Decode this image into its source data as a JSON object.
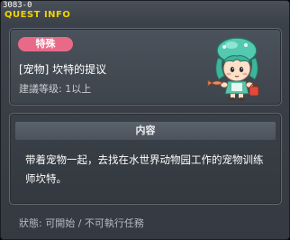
{
  "window": {
    "quest_id": "3083-0",
    "title": "QUEST INFO"
  },
  "quest": {
    "type_badge": "特殊",
    "name": "[宠物] 坎特的提议",
    "level": "建議等级: 1以上",
    "npc_icon": "npc-character-icon"
  },
  "content": {
    "header": "内容",
    "description": "带着宠物一起，去找在水世界动物园工作的宠物训练师坎特。"
  },
  "status": {
    "text": "狀態: 可開始 / 不可執行任務"
  },
  "colors": {
    "title_yellow": "#f0d400",
    "badge_pink": "#e96a88",
    "panel_bg": "#3e444c"
  }
}
